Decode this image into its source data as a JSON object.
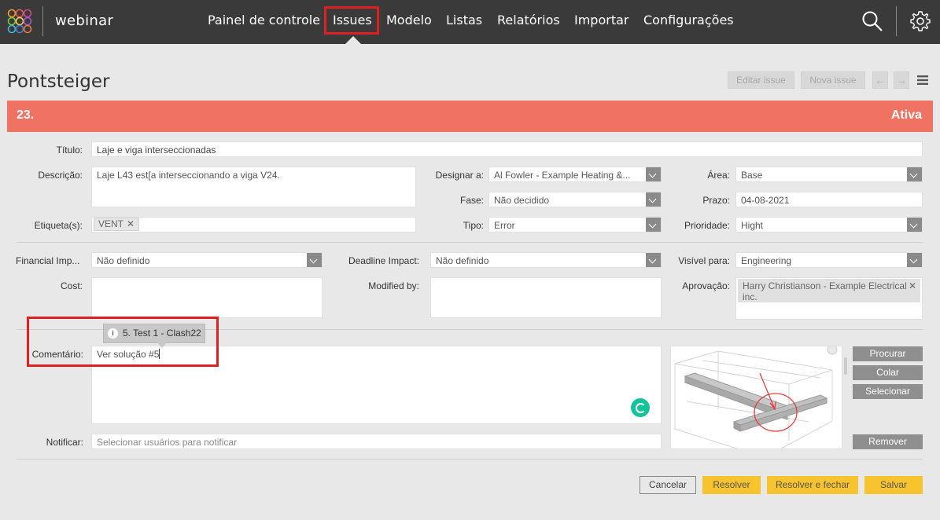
{
  "topbar": {
    "brand": "webinar",
    "nav": [
      "Painel de controle",
      "Issues",
      "Modelo",
      "Listas",
      "Relatórios",
      "Importar",
      "Configurações"
    ],
    "active_nav": "Issues",
    "icons": [
      "logo-icon",
      "search-icon",
      "gear-icon"
    ]
  },
  "page": {
    "title": "Pontsteiger",
    "edit_label": "Editar issue",
    "new_label": "Nova issue",
    "prev_arrow": "←",
    "next_arrow": "→"
  },
  "issue": {
    "number": "23.",
    "status": "Ativa",
    "banner_color": "#f07263"
  },
  "form": {
    "titulo_label": "Título:",
    "titulo_value": "Laje e viga interseccionadas",
    "descricao_label": "Descrição:",
    "descricao_value": "Laje L43 est[a interseccionando a viga V24.",
    "etiquetas_label": "Etiqueta(s):",
    "tag": "VENT",
    "tag_remove": "✕",
    "designar_label": "Designar a:",
    "designar_value": "Al Fowler - Example Heating &...",
    "fase_label": "Fase:",
    "fase_value": "Não decidido",
    "tipo_label": "Tipo:",
    "tipo_value": "Error",
    "area_label": "Área:",
    "area_value": "Base",
    "prazo_label": "Prazo:",
    "prazo_value": "04-08-2021",
    "prioridade_label": "Prioridade:",
    "prioridade_value": "Hight",
    "financial_label": "Financial Imp...",
    "financial_value": "Não definido",
    "deadline_label": "Deadline Impact:",
    "deadline_value": "Não definido",
    "visivel_label": "Visível para:",
    "visivel_value": "Engineering",
    "cost_label": "Cost:",
    "modified_label": "Modified by:",
    "aprovacao_label": "Aprovação:",
    "aprovacao_value": "Harry Christianson - Example Electrical inc.",
    "aprovacao_remove": "✕",
    "tooltip_icon": "i",
    "tooltip_text": "5. Test 1 - Clash22",
    "comentario_label": "Comentário:",
    "comentario_value": "Ver solução #5",
    "notificar_label": "Notificar:",
    "notificar_placeholder": "Selecionar usuários para notificar"
  },
  "viewpoint_buttons": {
    "procurar": "Procurar",
    "colar": "Colar",
    "selecionar": "Selecionar",
    "remover": "Remover"
  },
  "footer": {
    "cancelar": "Cancelar",
    "resolver": "Resolver",
    "resolver_fechar": "Resolver e fechar",
    "salvar": "Salvar"
  },
  "colors": {
    "nav_bg": "#3a3a3a",
    "highlight": "#e02020",
    "primary_button": "#f7c32e"
  }
}
